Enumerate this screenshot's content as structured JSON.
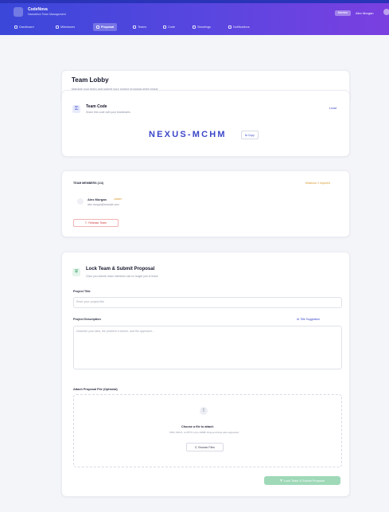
{
  "app": {
    "brand_name": "CodeNova",
    "brand_sub": "Hackathon Team Management",
    "user_badge": "Member",
    "user_name": "Alex Morgan"
  },
  "nav": {
    "items": [
      {
        "label": "Dashboard",
        "icon": "grid-icon",
        "active": false
      },
      {
        "label": "Milestones",
        "icon": "flag-icon",
        "active": false
      },
      {
        "label": "Proposal",
        "icon": "document-icon",
        "active": true
      },
      {
        "label": "Teams",
        "icon": "users-icon",
        "active": false
      },
      {
        "label": "Code",
        "icon": "code-icon",
        "active": false
      },
      {
        "label": "Standings",
        "icon": "trophy-icon",
        "active": false
      },
      {
        "label": "Notifications",
        "icon": "bell-icon",
        "active": false
      }
    ]
  },
  "lobby": {
    "title": "Team Lobby",
    "subtitle": "Manage your team and submit your project proposal when ready"
  },
  "team_code": {
    "title": "Team Code",
    "subtitle": "Share this code with your teammates",
    "badge": "Lead",
    "code": "NEXUS-MCHM",
    "copy_label": "Copy"
  },
  "members": {
    "heading": "TEAM MEMBERS (1/4)",
    "warning": "Minimum 2 required",
    "list": [
      {
        "name": "Alex Morgan",
        "role": "Leader",
        "email": "alex.morgan@example.com"
      }
    ],
    "leave_label": "Release Team"
  },
  "proposal": {
    "title": "Lock Team & Submit Proposal",
    "subtitle": "Once you submit, team members can no longer join or leave",
    "project_title_label": "Project Title",
    "project_title_placeholder": "Enter your project title",
    "description_label": "Project Description",
    "ai_link": "AI Title Suggestion",
    "description_placeholder": "Describe your idea, the problem it solves, and the approach...",
    "attach_label": "Attach Proposal File (Optional)",
    "upload_title": "Choose a file to attach",
    "upload_hint": "PDF, DOCX, or PPTX up to 10MB. Drag and drop also supported.",
    "browse_label": "Browse Files",
    "submit_label": "Lock Team & Submit Proposal"
  },
  "colors": {
    "header_start": "#3a47d9",
    "header_end": "#7b3fe0",
    "accent": "#3c47c8",
    "danger": "#d33a3a",
    "success": "#9fd9b8",
    "warning": "#d9962b"
  }
}
